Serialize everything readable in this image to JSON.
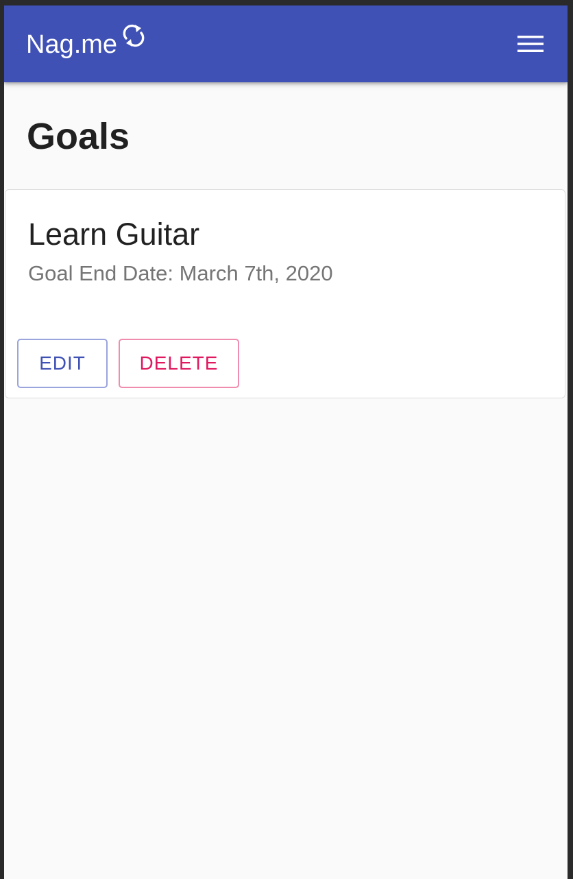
{
  "app": {
    "brand_name": "Nag.me",
    "brand_icon": "sync-icon",
    "menu_icon": "hamburger-menu-icon"
  },
  "page": {
    "title": "Goals"
  },
  "goals": [
    {
      "title": "Learn Guitar",
      "end_date_text": "Goal End Date: March 7th, 2020",
      "actions": {
        "edit_label": "EDIT",
        "delete_label": "DELETE"
      }
    }
  ],
  "colors": {
    "primary": "#3f51b5",
    "danger": "#e0185f",
    "background": "#fafafa",
    "card": "#ffffff"
  }
}
